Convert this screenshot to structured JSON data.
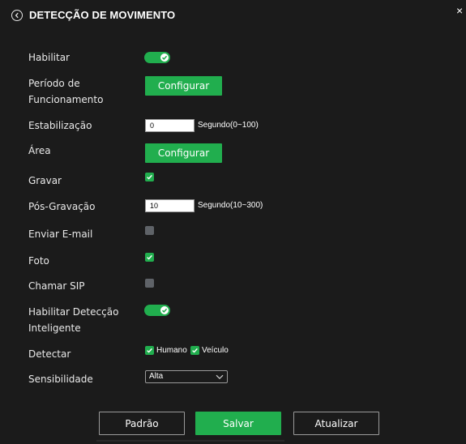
{
  "dialog": {
    "title": "DETECÇÃO DE MOVIMENTO",
    "close_glyph": "×",
    "back_icon": "chevron-left-circle-icon"
  },
  "colors": {
    "accent": "#21ae4e",
    "background": "#1b1b1b",
    "unchecked": "#5f6368"
  },
  "fields": {
    "habilitar": {
      "label": "Habilitar",
      "enabled": true
    },
    "periodo": {
      "label_line1": "Período de",
      "label_line2": "Funcionamento",
      "button": "Configurar"
    },
    "estabilizacao": {
      "label": "Estabilização",
      "value": "0",
      "unit": "Segundo(0~100)"
    },
    "area": {
      "label": "Área",
      "button": "Configurar"
    },
    "gravar": {
      "label": "Gravar",
      "checked": true
    },
    "pos_gravacao": {
      "label": "Pós-Gravação",
      "value": "10",
      "unit": "Segundo(10~300)"
    },
    "enviar_email": {
      "label": "Enviar E-mail",
      "checked": false
    },
    "foto": {
      "label": "Foto",
      "checked": true
    },
    "chamar_sip": {
      "label": "Chamar SIP",
      "checked": false
    },
    "deteccao_inteligente": {
      "label_line1": "Habilitar Detecção",
      "label_line2": "Inteligente",
      "enabled": true
    },
    "detectar": {
      "label": "Detectar",
      "options": [
        {
          "label": "Humano",
          "checked": true
        },
        {
          "label": "Veículo",
          "checked": true
        }
      ]
    },
    "sensibilidade": {
      "label": "Sensibilidade",
      "selected": "Alta"
    }
  },
  "footer": {
    "default_label": "Padrão",
    "save_label": "Salvar",
    "refresh_label": "Atualizar"
  }
}
